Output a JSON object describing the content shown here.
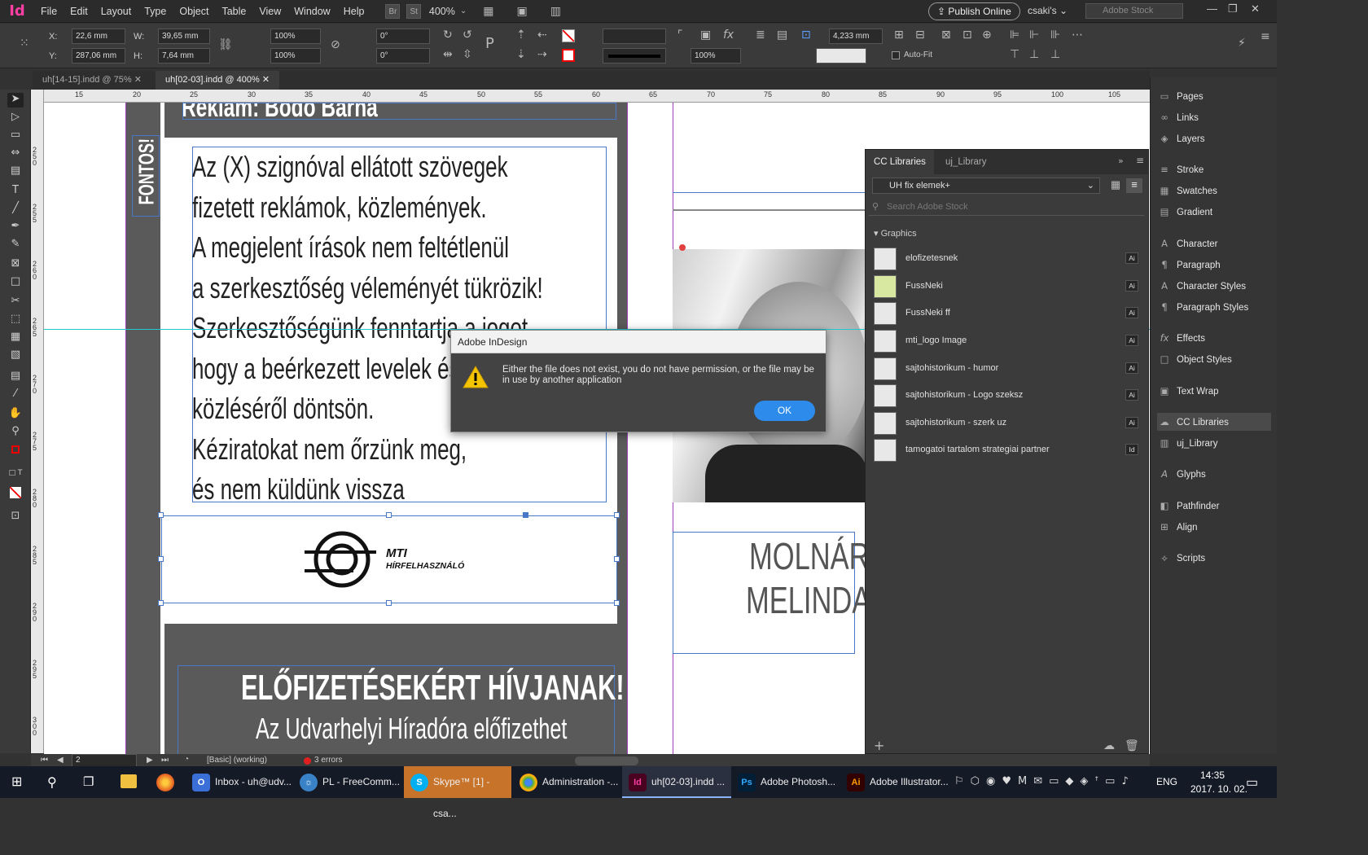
{
  "app": {
    "logo": "Id",
    "menu": [
      "File",
      "Edit",
      "Layout",
      "Type",
      "Object",
      "Table",
      "View",
      "Window",
      "Help"
    ],
    "bridge": "Br",
    "stock_btn": "St",
    "zoom": "400%",
    "publish": "Publish Online",
    "workspace": "csaki's",
    "search_placeholder": "Adobe Stock"
  },
  "control": {
    "x_label": "X:",
    "x_value": "22,6 mm",
    "y_label": "Y:",
    "y_value": "287,06 mm",
    "w_label": "W:",
    "w_value": "39,65 mm",
    "h_label": "H:",
    "h_value": "7,64 mm",
    "scale_x": "100%",
    "scale_y": "100%",
    "rotate": "0°",
    "shear": "0°",
    "opacity": "100%",
    "gap": "4,233 mm",
    "autofit": "Auto-Fit"
  },
  "tabs": [
    {
      "label": "uh[14-15].indd @ 75%"
    },
    {
      "label": "uh[02-03].indd @ 400%"
    }
  ],
  "ruler_top": [
    "15",
    "20",
    "25",
    "30",
    "35",
    "40",
    "45",
    "50",
    "55",
    "60",
    "65",
    "70",
    "75",
    "80",
    "85",
    "90",
    "95",
    "100",
    "105"
  ],
  "ruler_left": [
    "250",
    "255",
    "260",
    "265",
    "270",
    "275",
    "280",
    "285",
    "290",
    "295",
    "300",
    "305"
  ],
  "document": {
    "header_text": "Reklám: Bodó Barna",
    "side_label": "FONTOS!",
    "body_lines": [
      "Az (X) szignóval ellátott szövegek",
      "fizetett reklámok, közlemények.",
      "A megjelent írások nem feltétlenül",
      "a szerkesztőség véleményét tükrözik!",
      "Szerkesztőségünk fenntartja a jogot,",
      "hogy a beérkezett levelek és ma",
      "közléséről döntsön.",
      "Kéziratokat  nem őrzünk meg,",
      "és nem küldünk vissza"
    ],
    "logo_line1": "MTI",
    "logo_line2": "HÍRFELHASZNÁLÓ",
    "subscribe_title": "ELŐFIZETÉSEKÉRT  HÍVJANAK!",
    "subscribe_sub": "Az Udvarhelyi Híradóra előfizethet",
    "name_line1": "MOLNÁR",
    "name_line2": "MELINDA"
  },
  "status": {
    "page": "2",
    "style": "[Basic] (working)",
    "errors": "3 errors"
  },
  "panels": [
    {
      "label": "Pages",
      "icon": "▭"
    },
    {
      "label": "Links",
      "icon": "∞"
    },
    {
      "label": "Layers",
      "icon": "◈"
    },
    {
      "label": "Stroke",
      "icon": "≡"
    },
    {
      "label": "Swatches",
      "icon": "▦"
    },
    {
      "label": "Gradient",
      "icon": "▤"
    },
    {
      "label": "Character",
      "icon": "A"
    },
    {
      "label": "Paragraph",
      "icon": "¶"
    },
    {
      "label": "Character Styles",
      "icon": "A"
    },
    {
      "label": "Paragraph Styles",
      "icon": "¶"
    },
    {
      "label": "Effects",
      "icon": "fx"
    },
    {
      "label": "Object Styles",
      "icon": "□"
    },
    {
      "label": "Text Wrap",
      "icon": "▣"
    },
    {
      "label": "CC Libraries",
      "icon": "☁"
    },
    {
      "label": "uj_Library",
      "icon": "▥"
    },
    {
      "label": "Glyphs",
      "icon": "A"
    },
    {
      "label": "Pathfinder",
      "icon": "◧"
    },
    {
      "label": "Align",
      "icon": "⊞"
    },
    {
      "label": "Scripts",
      "icon": "⟡"
    }
  ],
  "cc_libraries": {
    "tab1": "CC Libraries",
    "tab2": "uj_Library",
    "library": "UH fix elemek+",
    "search": "Search Adobe Stock",
    "section": "Graphics",
    "items": [
      {
        "name": "elofizetesnek",
        "type": "Ai"
      },
      {
        "name": "FussNeki",
        "type": "Ai"
      },
      {
        "name": "FussNeki ff",
        "type": "Ai"
      },
      {
        "name": "mti_logo Image",
        "type": "Ai"
      },
      {
        "name": "sajtohistorikum - humor",
        "type": "Ai"
      },
      {
        "name": "sajtohistorikum - Logo szeksz",
        "type": "Ai"
      },
      {
        "name": "sajtohistorikum - szerk uz",
        "type": "Ai"
      },
      {
        "name": "tamogatoi tartalom strategiai partner",
        "type": "Id"
      }
    ]
  },
  "dialog": {
    "title": "Adobe InDesign",
    "message": "Either the file does not exist, you do not have permission, or the file may be in use by another application",
    "ok": "OK"
  },
  "taskbar": {
    "items": [
      {
        "label": "Inbox - uh@udv...",
        "color": "#3a6fd8"
      },
      {
        "label": "PL - FreeComm...",
        "color": "#3a82c8"
      },
      {
        "label": "Skype™ [1] - csa...",
        "color": "#00aff0"
      },
      {
        "label": "Administration -...",
        "color": "#e0a030"
      },
      {
        "label": "uh[02-03].indd ...",
        "color": "#ff3fa4"
      },
      {
        "label": "Adobe Photosh...",
        "color": "#31a8ff"
      },
      {
        "label": "Adobe Illustrator...",
        "color": "#ff9a00"
      }
    ],
    "lang": "ENG",
    "time": "14:35",
    "date": "2017. 10. 02."
  }
}
